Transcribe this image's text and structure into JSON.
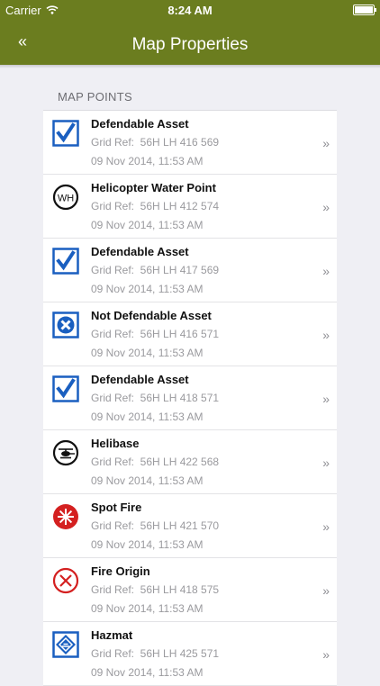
{
  "status_bar": {
    "carrier": "Carrier",
    "time": "8:24 AM"
  },
  "nav": {
    "back_icon": "«",
    "title": "Map Properties"
  },
  "section": {
    "header": "MAP POINTS"
  },
  "items": [
    {
      "icon": "defendable",
      "name": "Defendable Asset",
      "grid_ref": "Grid Ref:  56H LH 416 569",
      "date": "09 Nov 2014, 11:53 AM"
    },
    {
      "icon": "wh",
      "name": "Helicopter Water Point",
      "grid_ref": "Grid Ref:  56H LH 412 574",
      "date": "09 Nov 2014, 11:53 AM"
    },
    {
      "icon": "defendable",
      "name": "Defendable Asset",
      "grid_ref": "Grid Ref:  56H LH 417 569",
      "date": "09 Nov 2014, 11:53 AM"
    },
    {
      "icon": "not-defendable",
      "name": "Not Defendable Asset",
      "grid_ref": "Grid Ref:  56H LH 416 571",
      "date": "09 Nov 2014, 11:53 AM"
    },
    {
      "icon": "defendable",
      "name": "Defendable Asset",
      "grid_ref": "Grid Ref:  56H LH 418 571",
      "date": "09 Nov 2014, 11:53 AM"
    },
    {
      "icon": "helibase",
      "name": "Helibase",
      "grid_ref": "Grid Ref:  56H LH 422 568",
      "date": "09 Nov 2014, 11:53 AM"
    },
    {
      "icon": "spot-fire",
      "name": "Spot Fire",
      "grid_ref": "Grid Ref:  56H LH 421 570",
      "date": "09 Nov 2014, 11:53 AM"
    },
    {
      "icon": "fire-origin",
      "name": "Fire Origin",
      "grid_ref": "Grid Ref:  56H LH 418 575",
      "date": "09 Nov 2014, 11:53 AM"
    },
    {
      "icon": "hazmat",
      "name": "Hazmat",
      "grid_ref": "Grid Ref:  56H LH 425 571",
      "date": "09 Nov 2014, 11:53 AM"
    }
  ],
  "chevron": "»",
  "colors": {
    "nav": "#6b7d1f",
    "blue": "#1a5fc0",
    "red": "#d42020"
  }
}
